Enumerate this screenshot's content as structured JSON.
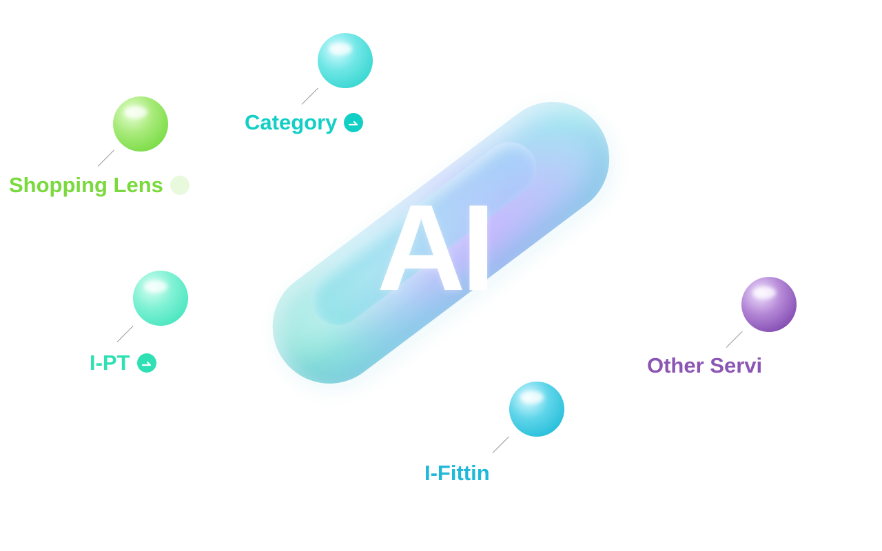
{
  "center": {
    "title": "AI"
  },
  "nodes": [
    {
      "key": "category",
      "label": "Category",
      "color": "#12cfc6",
      "has_arrow": true
    },
    {
      "key": "shopping",
      "label": "Shopping Lens",
      "color": "#79d93d",
      "has_arrow": true
    },
    {
      "key": "ipt",
      "label": "I-PT",
      "color": "#2ee0b3",
      "has_arrow": true
    },
    {
      "key": "other",
      "label": "Other Servi",
      "color": "#8b55b3",
      "has_arrow": false
    },
    {
      "key": "fitting",
      "label": "I-Fittin",
      "color": "#20b8d9",
      "has_arrow": false
    }
  ],
  "icons": {
    "arrow": "arrow-right-icon",
    "orb": "sphere-icon"
  }
}
